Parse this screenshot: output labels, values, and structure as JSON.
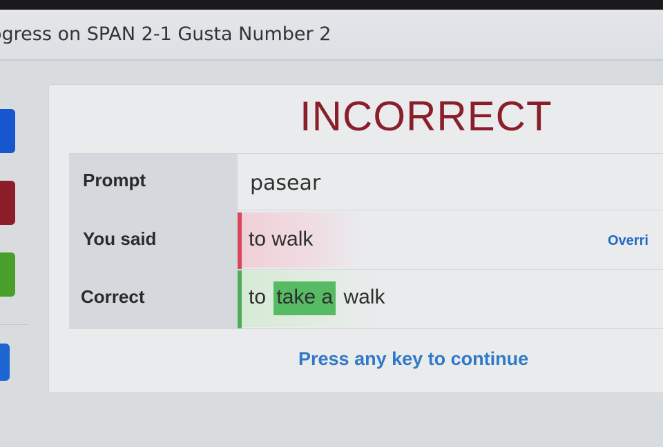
{
  "header": {
    "title": "ogress on SPAN 2-1 Gusta Number 2"
  },
  "result": {
    "verdict": "INCORRECT"
  },
  "rows": {
    "prompt": {
      "label": "Prompt",
      "value": "pasear"
    },
    "you_said": {
      "label": "You said",
      "value": "to walk",
      "status_color": "#d9465c"
    },
    "correct": {
      "label": "Correct",
      "before": "to",
      "highlight": "take a",
      "after": "walk",
      "status_color": "#4dae5a",
      "highlight_color": "#56bb63"
    }
  },
  "override_label": "Overri",
  "continue_label": "Press any key to continue",
  "colors": {
    "verdict": "#8a1f2b",
    "link": "#3079c7",
    "side_buttons": [
      "#1656cf",
      "#8e1d2a",
      "#4a9f2a",
      "#1c66d1"
    ]
  }
}
